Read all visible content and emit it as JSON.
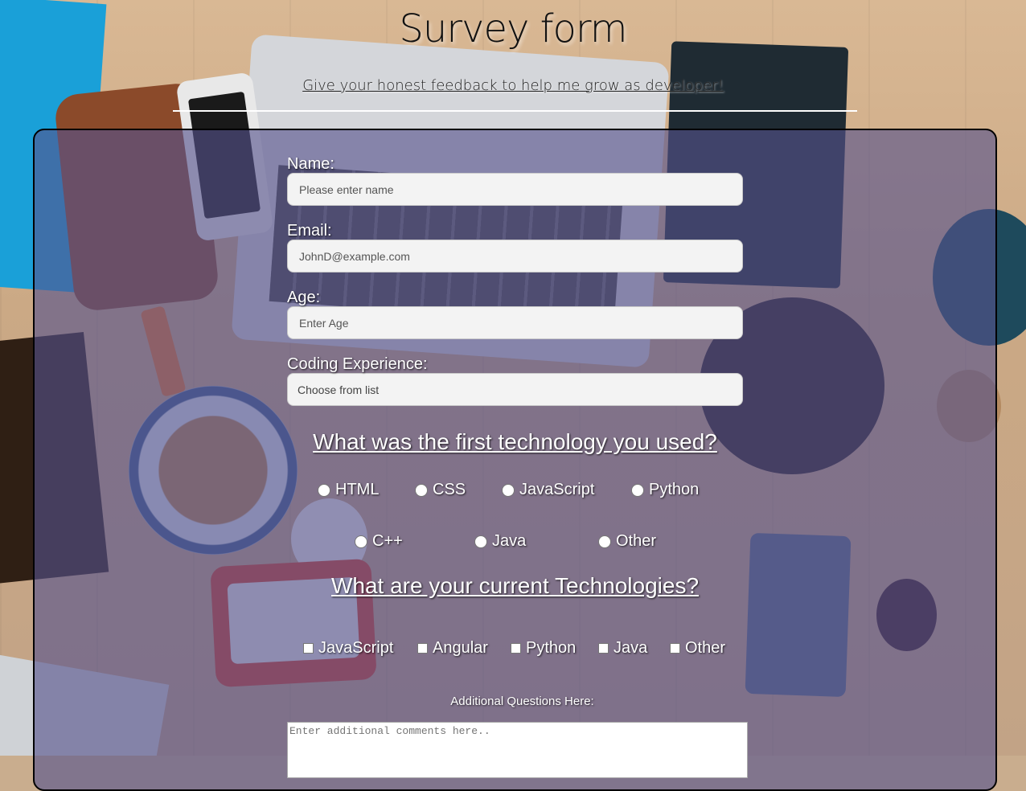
{
  "header": {
    "title": "Survey form",
    "subtitle": "Give your honest feedback to help me grow as developer!"
  },
  "form": {
    "name": {
      "label": "Name:",
      "placeholder": "Please enter name"
    },
    "email": {
      "label": "Email:",
      "placeholder": "JohnD@example.com"
    },
    "age": {
      "label": "Age:",
      "placeholder": "Enter Age"
    },
    "experience": {
      "label": "Coding Experience:",
      "selected": "Choose from list"
    },
    "first_tech": {
      "question": "What was the first technology you used?",
      "options": [
        "HTML",
        "CSS",
        "JavaScript",
        "Python",
        "C++",
        "Java",
        "Other"
      ]
    },
    "current_tech": {
      "question": "What are your current Technologies?",
      "options": [
        "JavaScript",
        "Angular",
        "Python",
        "Java",
        "Other"
      ]
    },
    "additional": {
      "label": "Additional Questions Here:",
      "placeholder": "Enter additional comments here.."
    }
  },
  "colors": {
    "panel": "#56528c",
    "panel_border": "#000000",
    "text": "#ffffff"
  }
}
